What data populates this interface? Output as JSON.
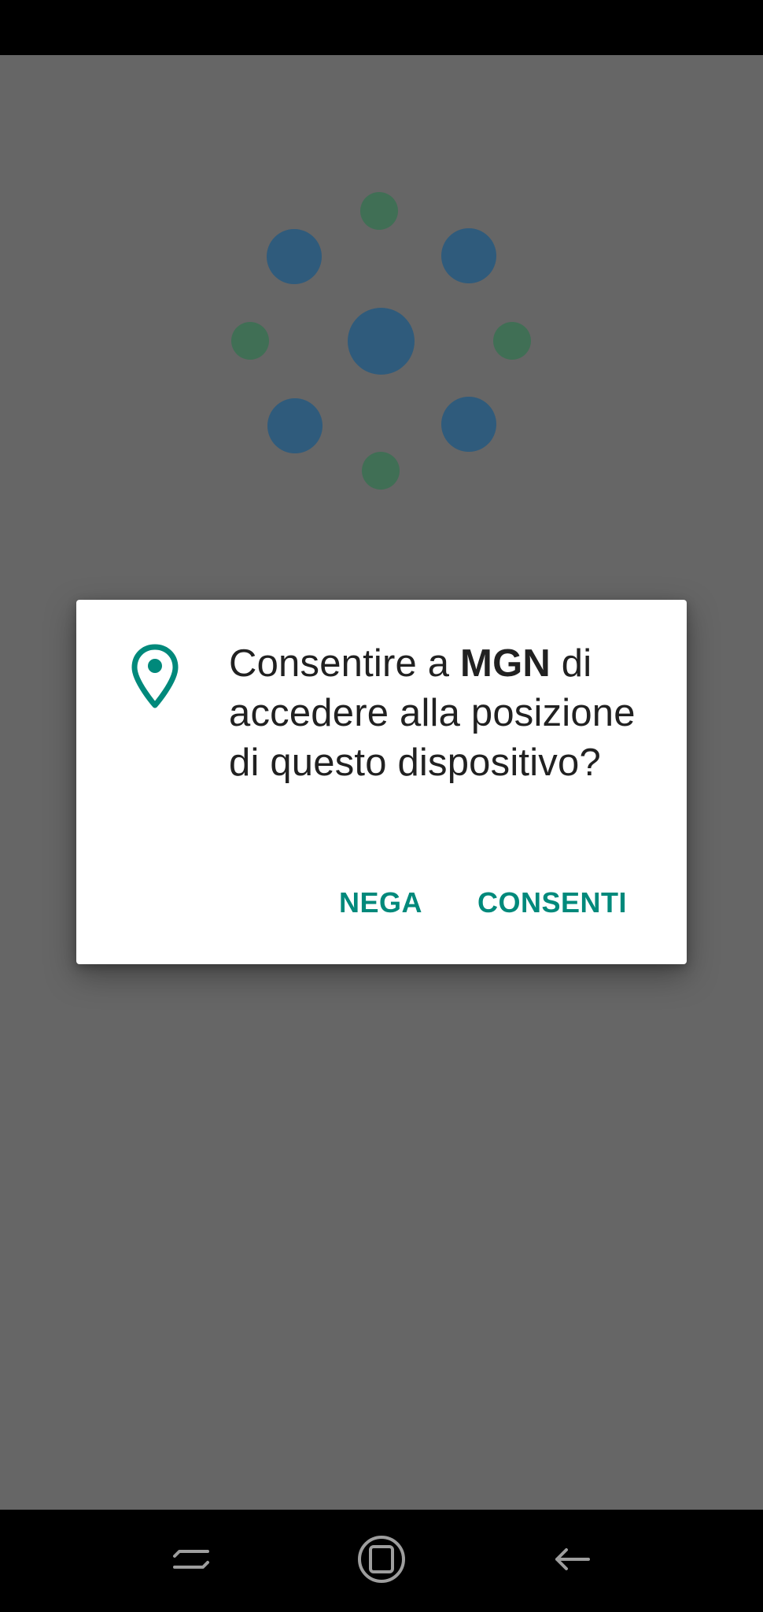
{
  "dialog": {
    "message_prefix": "Consentire a ",
    "app_name": "MGN",
    "message_suffix": " di accedere alla posizione di questo dispositivo?",
    "deny_label": "NEGA",
    "allow_label": "CONSENTI",
    "icon": "location-pin-icon"
  },
  "colors": {
    "accent": "#00897b",
    "scrim_background": "#666666",
    "logo_blue": "#2f5b7c",
    "logo_green": "#406f55"
  },
  "navigation": {
    "buttons": [
      "recents-icon",
      "home-icon",
      "back-icon"
    ]
  }
}
